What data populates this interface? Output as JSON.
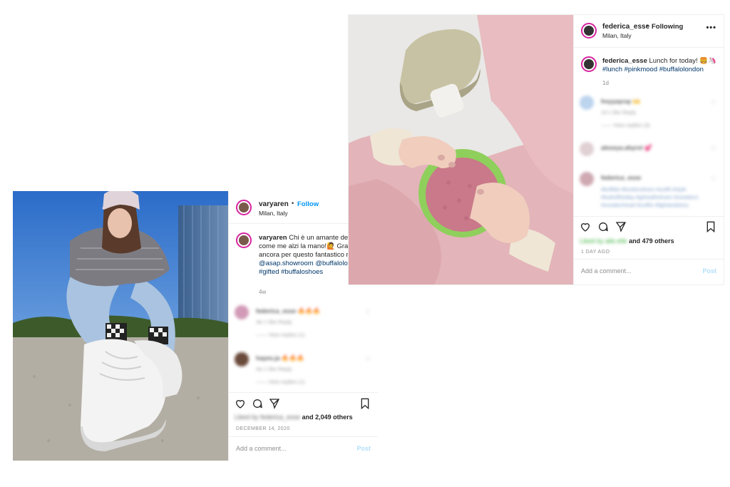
{
  "post1": {
    "username": "varyaren",
    "follow_label": "Follow",
    "location": "Milan, Italy",
    "caption_username": "varyaren",
    "caption_text": "Chi è un amante delle Buffalo come me alzi la mano!🙋 Grazie ancora per questo fantastico regalo 😊",
    "caption_tags": "@asap.showroom @buffalolondon #gifted #buffaloshoes",
    "caption_age": "4w",
    "comments": [
      {
        "name": "federica_esse 🔥🔥🔥",
        "meta": "4w  1 like  Reply",
        "replies": "—— View replies (1)"
      },
      {
        "name": "hayes.ja 🔥🔥🔥",
        "meta": "4w  1 like  Reply",
        "replies": "—— View replies (1)"
      }
    ],
    "likes_blurred": "Liked by federica_esse",
    "likes_count": "and 2,049 others",
    "date": "DECEMBER 14, 2020",
    "add_comment_placeholder": "Add a comment...",
    "post_label": "Post"
  },
  "post2": {
    "username": "federica_esse",
    "follow_label": "Following",
    "location": "Milan, Italy",
    "caption_username": "federica_esse",
    "caption_text": "Lunch for today! 🍔🦄",
    "caption_tags": "#lunch #pinkmood #buffalolondon",
    "caption_age": "1d",
    "comments": [
      {
        "name": "freyyayray 🙌",
        "meta": "1d  1 like  Reply",
        "replies": "—— View replies (3)"
      },
      {
        "name": "alessya.ahyrol 💕",
        "meta": "",
        "replies": ""
      },
      {
        "name": "federica_esse",
        "meta": "#buffalo #londonshoes #outfit #style #lookoftheday #girlswithshoes #sneakers #sneakerhead #outfits #lightandstory",
        "replies": ""
      }
    ],
    "likes_blurred": "Liked by aile.elle",
    "likes_count": "and 479 others",
    "date": "1 DAY AGO",
    "add_comment_placeholder": "Add a comment...",
    "post_label": "Post"
  },
  "colors": {
    "follow_blue": "#0095f6",
    "tag_blue": "#00376b",
    "story_ring": "#d6249f"
  },
  "icons": [
    "heart-icon",
    "comment-icon",
    "share-icon",
    "bookmark-icon",
    "more-icon"
  ]
}
